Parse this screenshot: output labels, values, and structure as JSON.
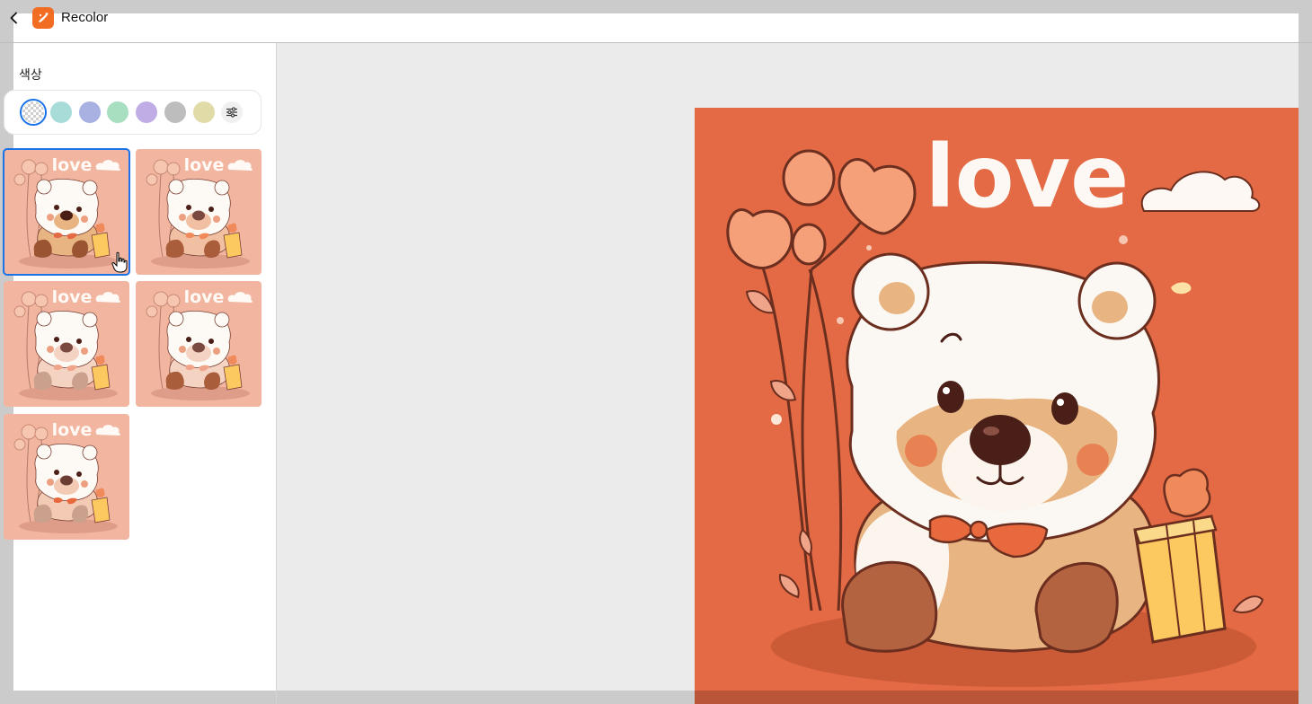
{
  "header": {
    "title": "Recolor",
    "back_icon": "chevron-left-icon",
    "logo_icon": "recolor-app-icon",
    "logo_color": "#f26d21"
  },
  "sidebar": {
    "section_label": "색상",
    "swatches": [
      {
        "name": "transparent",
        "color": "transparent",
        "selected": true
      },
      {
        "name": "teal",
        "color": "#a8dcd9"
      },
      {
        "name": "periwinkle",
        "color": "#a9b0e2"
      },
      {
        "name": "mint",
        "color": "#a8dfc1"
      },
      {
        "name": "lavender",
        "color": "#c0ade6"
      },
      {
        "name": "gray",
        "color": "#bdbdbd"
      },
      {
        "name": "khaki",
        "color": "#e1dba8"
      }
    ],
    "more_icon": "sliders-icon",
    "thumbnails": [
      {
        "variant": 1,
        "selected": true
      },
      {
        "variant": 2
      },
      {
        "variant": 3
      },
      {
        "variant": 4
      },
      {
        "variant": 5
      }
    ]
  },
  "preview": {
    "image_text": "love",
    "background_color": "#e36a44"
  },
  "colors": {
    "accent": "#1a73e8",
    "canvas_bg": "#ebebeb",
    "thumb_bg": "#f2b6a0"
  }
}
